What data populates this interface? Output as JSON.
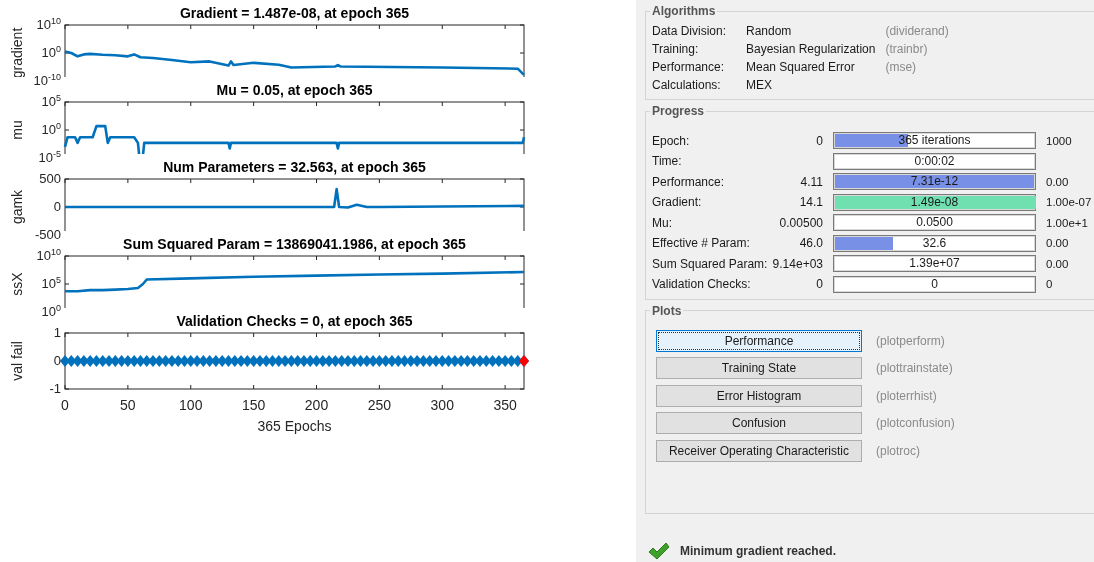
{
  "figure": {
    "subplots": [
      {
        "kind": "log_plot",
        "title": "Gradient = 1.487e-08, at epoch 365",
        "ylabel": "gradient",
        "ytick_labels": [
          "10$^{10}$",
          "10$^{0}$",
          "10$^{-10}$"
        ]
      },
      {
        "kind": "log_plot",
        "title": "Mu = 0.05, at epoch 365",
        "ylabel": "mu",
        "ytick_labels": [
          "10$^{5}$",
          "10$^{0}$",
          "10$^{-5}$"
        ]
      },
      {
        "kind": "chart",
        "chart_data": {
          "type": "line",
          "title": "Num Parameters = 32.563, at epoch 365",
          "ylabel": "gamk",
          "xlim": [
            0,
            365
          ],
          "ylim": [
            -500,
            500
          ],
          "yticks": [
            -500,
            0,
            500
          ],
          "x": [
            0,
            100,
            200,
            214,
            216,
            218,
            225,
            232,
            240,
            250,
            300,
            365
          ],
          "series": [
            {
              "color": "#0072bd",
              "values": [
                0,
                0,
                0,
                0,
                320,
                0,
                -10,
                40,
                0,
                0,
                10,
                20
              ]
            }
          ]
        }
      },
      {
        "kind": "log_plot",
        "title": "Sum Squared Param = 13869041.1986, at epoch 365",
        "ylabel": "ssX",
        "ytick_labels": [
          "10$^{10}$",
          "10$^{5}$",
          "10$^{0}$"
        ]
      },
      {
        "kind": "chart",
        "chart_data": {
          "type": "scatter",
          "title": "Validation Checks = 0, at epoch 365",
          "xlabel": "365 Epochs",
          "ylabel": "val fail",
          "xlim": [
            0,
            365
          ],
          "ylim": [
            -1,
            1
          ],
          "xticks": [
            0,
            50,
            100,
            150,
            200,
            250,
            300,
            350
          ],
          "yticks": [
            -1,
            0,
            1
          ],
          "x": [
            0,
            5,
            10,
            15,
            20,
            25,
            30,
            35,
            40,
            45,
            50,
            55,
            60,
            65,
            70,
            75,
            80,
            85,
            90,
            95,
            100,
            105,
            110,
            115,
            120,
            125,
            130,
            135,
            140,
            145,
            150,
            155,
            160,
            165,
            170,
            175,
            180,
            185,
            190,
            195,
            200,
            205,
            210,
            215,
            220,
            225,
            230,
            235,
            240,
            245,
            250,
            255,
            260,
            265,
            270,
            275,
            280,
            285,
            290,
            295,
            300,
            305,
            310,
            315,
            320,
            325,
            330,
            335,
            340,
            345,
            350,
            355,
            360,
            365
          ],
          "series": [
            {
              "color": "#0072bd",
              "values": [
                0,
                0,
                0,
                0,
                0,
                0,
                0,
                0,
                0,
                0,
                0,
                0,
                0,
                0,
                0,
                0,
                0,
                0,
                0,
                0,
                0,
                0,
                0,
                0,
                0,
                0,
                0,
                0,
                0,
                0,
                0,
                0,
                0,
                0,
                0,
                0,
                0,
                0,
                0,
                0,
                0,
                0,
                0,
                0,
                0,
                0,
                0,
                0,
                0,
                0,
                0,
                0,
                0,
                0,
                0,
                0,
                0,
                0,
                0,
                0,
                0,
                0,
                0,
                0,
                0,
                0,
                0,
                0,
                0,
                0,
                0,
                0,
                0,
                0
              ]
            },
            {
              "color": "#ff0000",
              "values": [
                null,
                null,
                null,
                null,
                null,
                null,
                null,
                null,
                null,
                null,
                null,
                null,
                null,
                null,
                null,
                null,
                null,
                null,
                null,
                null,
                null,
                null,
                null,
                null,
                null,
                null,
                null,
                null,
                null,
                null,
                null,
                null,
                null,
                null,
                null,
                null,
                null,
                null,
                null,
                null,
                null,
                null,
                null,
                null,
                null,
                null,
                null,
                null,
                null,
                null,
                null,
                null,
                null,
                null,
                null,
                null,
                null,
                null,
                null,
                null,
                null,
                null,
                null,
                null,
                null,
                null,
                null,
                null,
                null,
                null,
                null,
                null,
                null,
                0
              ]
            }
          ]
        }
      }
    ]
  },
  "algorithms": {
    "title": "Algorithms",
    "rows": [
      {
        "label": "Data Division:",
        "value": "Random",
        "hint": "(dividerand)"
      },
      {
        "label": "Training:",
        "value": "Bayesian Regularization",
        "hint": "(trainbr)"
      },
      {
        "label": "Performance:",
        "value": "Mean Squared Error",
        "hint": "(mse)"
      },
      {
        "label": "Calculations:",
        "value": "MEX"
      }
    ]
  },
  "progress": {
    "title": "Progress",
    "rows": [
      {
        "label": "Epoch:",
        "start": "0",
        "value": "365 iterations",
        "end": "1000",
        "level": 0.365,
        "color": "#7891e6"
      },
      {
        "label": "Time:",
        "value": "0:00:02"
      },
      {
        "label": "Performance:",
        "start": "4.11",
        "value": "7.31e-12",
        "end": "0.00",
        "level": 0.99,
        "color": "#7891e6"
      },
      {
        "label": "Gradient:",
        "start": "14.1",
        "value": "1.49e-08",
        "end": "1.00e-07",
        "level": 1,
        "color": "#70e0b0"
      },
      {
        "label": "Mu:",
        "start": "0.00500",
        "value": "0.0500",
        "end": "1.00e+1"
      },
      {
        "label": "Effective # Param:",
        "start": "46.0",
        "value": "32.6",
        "end": "0.00",
        "level": 0.29,
        "color": "#7891e6"
      },
      {
        "label": "Sum Squared Param:",
        "start": "9.14e+03",
        "value": "1.39e+07",
        "end": "0.00"
      },
      {
        "label": "Validation Checks:",
        "start": "0",
        "value": "0",
        "end": "0"
      }
    ]
  },
  "plots": {
    "title": "Plots",
    "buttons": [
      {
        "label": "Performance",
        "hint": "(plotperform)",
        "focused": true
      },
      {
        "label": "Training State",
        "hint": "(plottrainstate)",
        "focused": false
      },
      {
        "label": "Error Histogram",
        "hint": "(ploterrhist)",
        "focused": false
      },
      {
        "label": "Confusion",
        "hint": "(plotconfusion)",
        "focused": false
      },
      {
        "label": "Receiver Operating Characteristic",
        "hint": "(plotroc)",
        "focused": false
      }
    ]
  },
  "status": {
    "kind": "success",
    "text": "Minimum gradient reached."
  }
}
